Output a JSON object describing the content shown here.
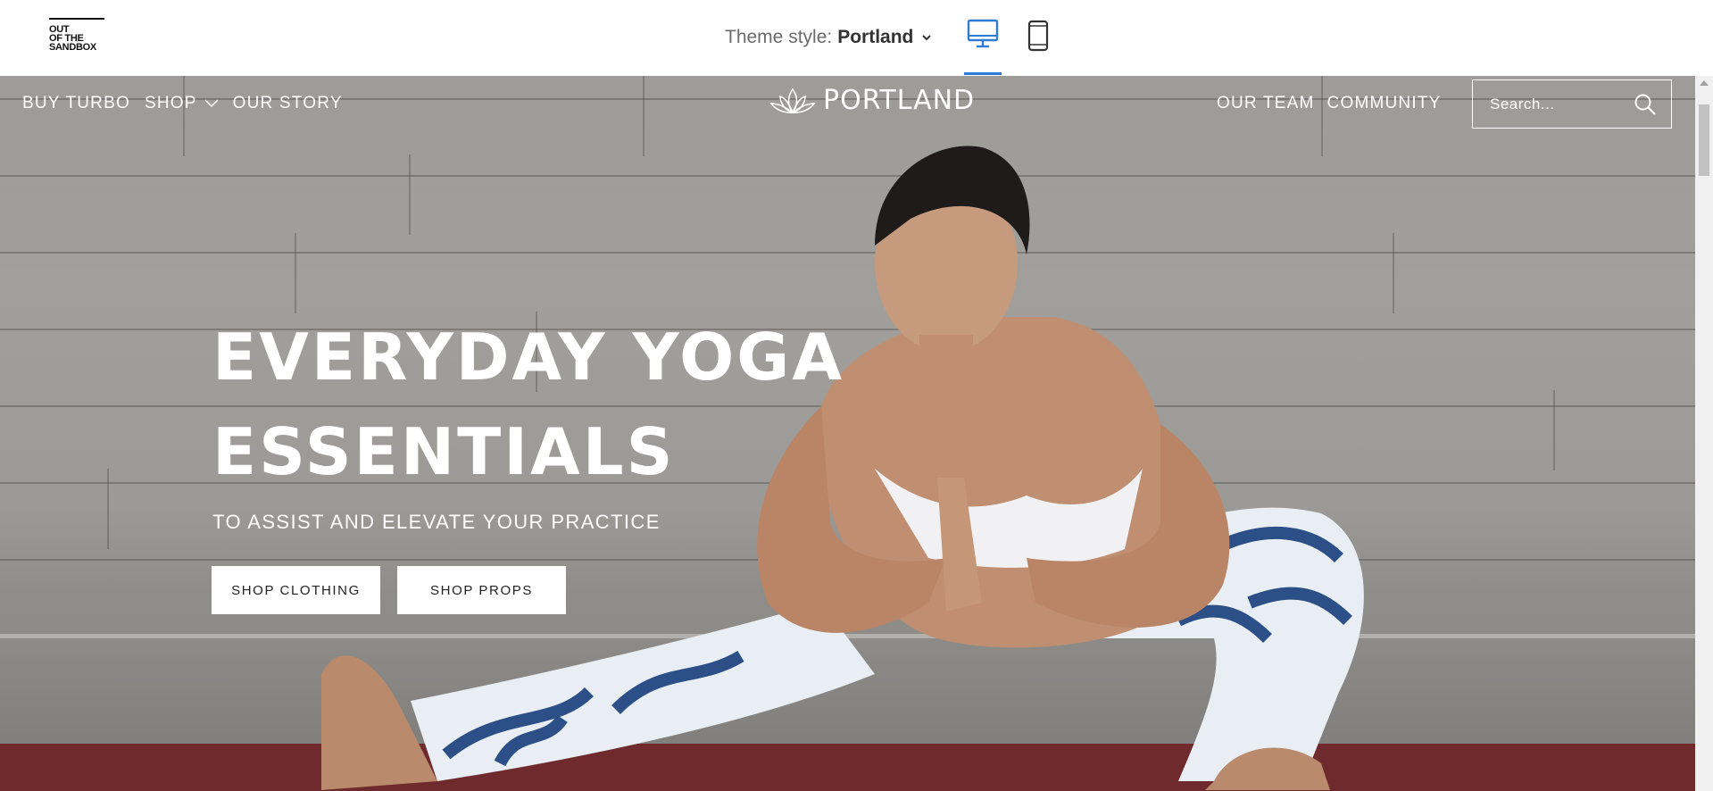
{
  "topbar": {
    "logo_lines": [
      "OUT",
      "OF THE",
      "SANDBOX"
    ],
    "theme_label": "Theme style:",
    "theme_value": "Portland",
    "devices": [
      "desktop-icon",
      "mobile-icon"
    ],
    "active_device": "desktop",
    "accent_color": "#2f7bd6"
  },
  "nav": {
    "left": [
      "BUY TURBO",
      "SHOP",
      "OUR STORY"
    ],
    "brand": "PORTLAND",
    "right": [
      "OUR TEAM",
      "COMMUNITY"
    ]
  },
  "search": {
    "placeholder": "Search..."
  },
  "hero": {
    "headline_line1": "EVERYDAY YOGA",
    "headline_line2": "ESSENTIALS",
    "subheadline": "TO ASSIST AND ELEVATE YOUR PRACTICE",
    "buttons": [
      "SHOP CLOTHING",
      "SHOP PROPS"
    ]
  }
}
